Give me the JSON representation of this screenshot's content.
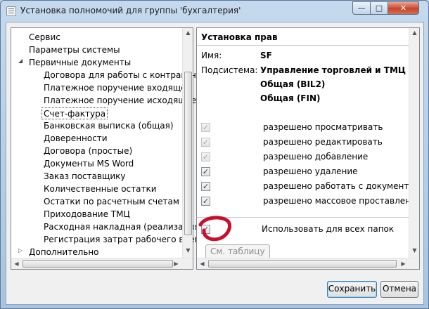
{
  "window": {
    "title": "Установка полномочий для группы 'бухгалтерия'",
    "minimize_glyph": "—",
    "maximize_glyph": "□",
    "close_glyph": "✕"
  },
  "tree": {
    "items": [
      {
        "label": "Сервис",
        "level": 0
      },
      {
        "label": "Параметры системы",
        "level": 0
      },
      {
        "label": "Первичные документы",
        "level": 0,
        "expanded": true
      },
      {
        "label": "Договора для работы с контрагента",
        "level": 1
      },
      {
        "label": "Платежное поручение входящее",
        "level": 1
      },
      {
        "label": "Платежное поручение исходящее",
        "level": 1
      },
      {
        "label": "Счет-фактура",
        "level": 1,
        "selected": true
      },
      {
        "label": "Банковская выписка (общая)",
        "level": 1
      },
      {
        "label": "Доверенности",
        "level": 1
      },
      {
        "label": "Договора (простые)",
        "level": 1
      },
      {
        "label": "Документы MS Word",
        "level": 1
      },
      {
        "label": "Заказ поставщику",
        "level": 1
      },
      {
        "label": "Количественные остатки",
        "level": 1
      },
      {
        "label": "Остатки по расчетным счетам",
        "level": 1
      },
      {
        "label": "Приходование ТМЦ",
        "level": 1
      },
      {
        "label": "Расходная накладная (реализация)",
        "level": 1
      },
      {
        "label": "Регистрация затрат рабочего време",
        "level": 1
      },
      {
        "label": "Дополнительно",
        "level": 0,
        "expanded": false
      }
    ],
    "expanded_glyph": "◢",
    "collapsed_glyph": "▷"
  },
  "rights": {
    "section_title": "Установка прав",
    "name_label": "Имя:",
    "name_value": "SF",
    "subsystem_label": "Подсистема:",
    "subsystems": [
      "Управление торговлей и ТМЦ (MTR",
      "Общая (BIL2)",
      "Общая (FIN)"
    ],
    "permissions": [
      {
        "label": "разрешено просматривать",
        "checked": true,
        "disabled": true
      },
      {
        "label": "разрешено редактировать",
        "checked": true,
        "disabled": true
      },
      {
        "label": "разрешено добавление",
        "checked": true,
        "disabled": true
      },
      {
        "label": "разрешено удаление",
        "checked": true,
        "disabled": false
      },
      {
        "label": "разрешено работать с документами д",
        "checked": true,
        "disabled": false
      },
      {
        "label": "разрешено массовое проставление з",
        "checked": true,
        "disabled": false
      }
    ],
    "use_for_all_folders": {
      "label": "Использовать для всех папок",
      "checked": true
    },
    "table_button": "См. таблицу",
    "check_glyph": "✓"
  },
  "buttons": {
    "save": "Сохранить",
    "cancel": "Отмена"
  },
  "colors": {
    "annotation_red": "#c8102e"
  }
}
